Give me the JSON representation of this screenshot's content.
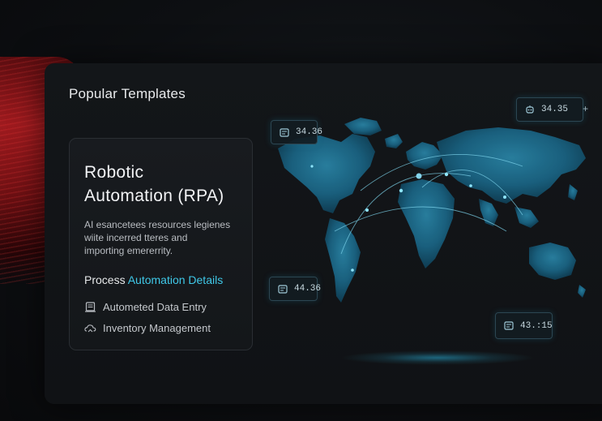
{
  "panel": {
    "title": "Popular Templates"
  },
  "card": {
    "title_line1": "Robotic",
    "title_line2": "Automation (RPA)",
    "desc_line1": "AI esancetees resources legienes",
    "desc_line2": "wiite incerred tteres and",
    "desc_line3": "importing emererrity.",
    "process_prefix": "Process",
    "process_accent": "Automation Details",
    "features": [
      {
        "label": "Autometed Data Entry",
        "icon": "document-stack-icon"
      },
      {
        "label": "Inventory Management",
        "icon": "cloud-arrow-icon"
      }
    ]
  },
  "badges": [
    {
      "value": "34.36",
      "icon": "server-icon"
    },
    {
      "value": "34.35",
      "icon": "robot-icon",
      "extra": "+"
    },
    {
      "value": "44.36",
      "icon": "server-icon"
    },
    {
      "value": "43.:15",
      "icon": "server-icon"
    }
  ],
  "colors": {
    "accent": "#3fc8e8",
    "map_fill": "#1a5f7e",
    "background": "#0d0f12",
    "red_glow": "#9e1a1e"
  }
}
